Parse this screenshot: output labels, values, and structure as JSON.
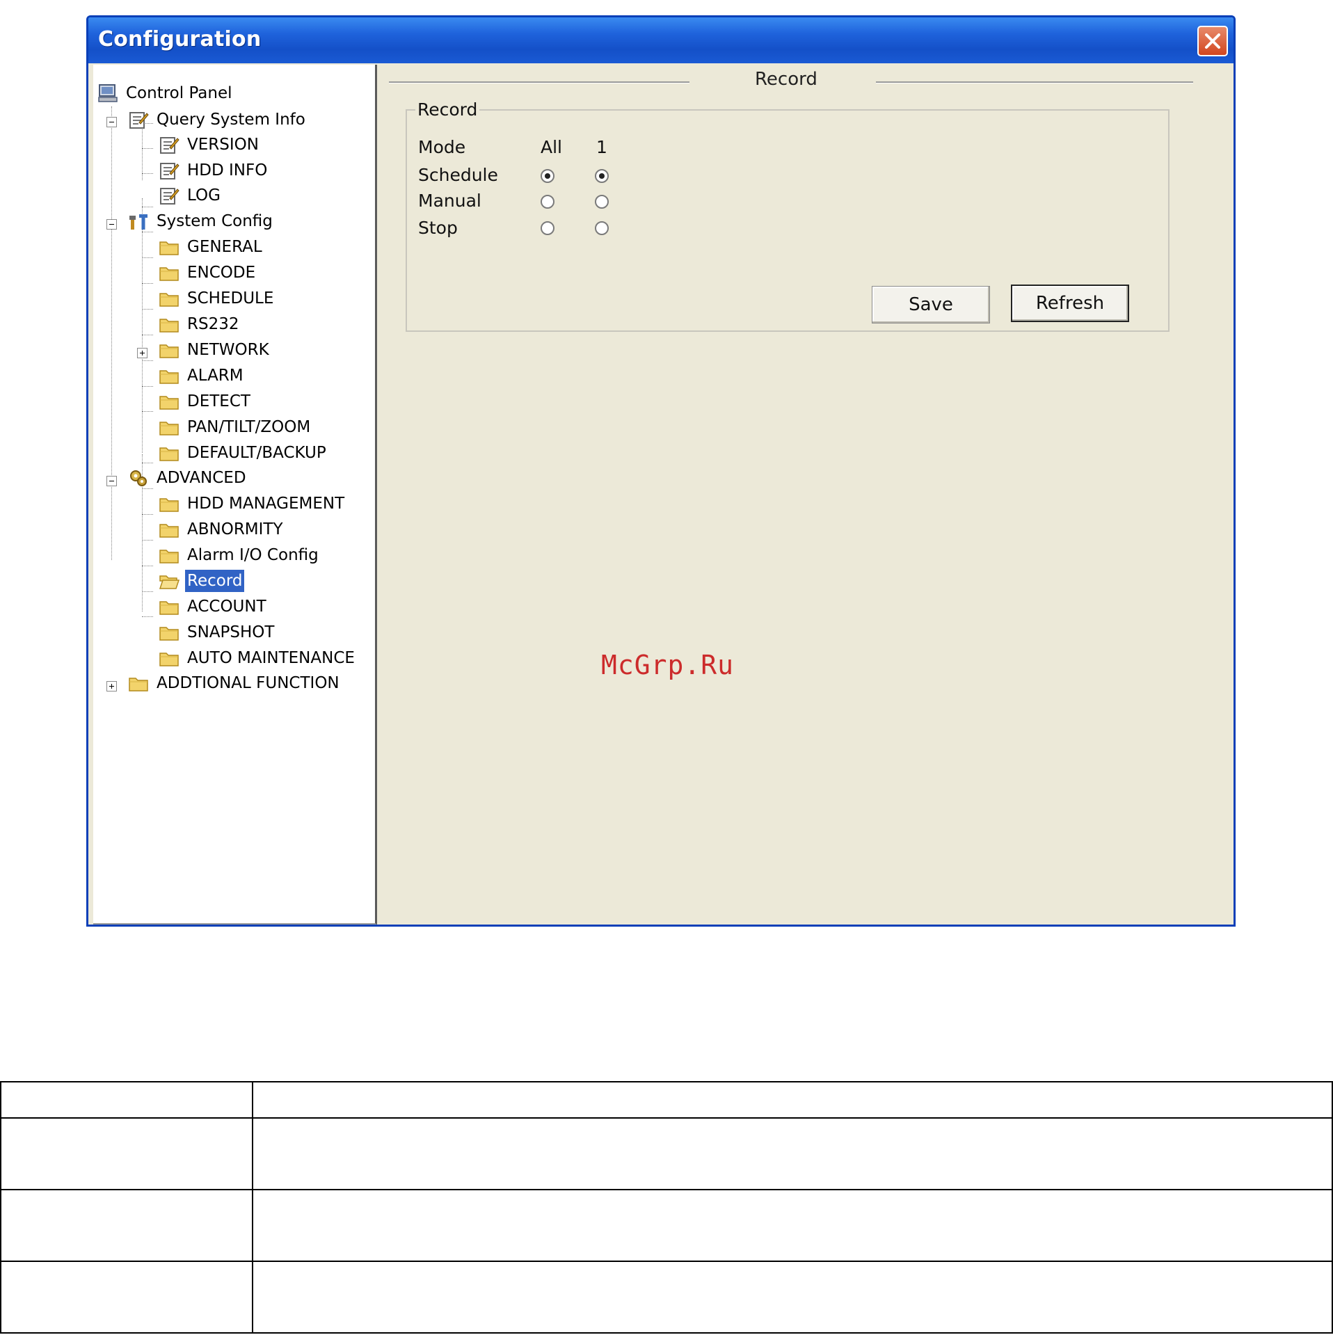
{
  "window": {
    "title": "Configuration",
    "close_icon": "close-icon"
  },
  "tree": {
    "root": "Control Panel",
    "query_system_info": {
      "label": "Query System Info",
      "children": [
        "VERSION",
        "HDD INFO",
        "LOG"
      ]
    },
    "system_config": {
      "label": "System Config",
      "children": [
        "GENERAL",
        "ENCODE",
        "SCHEDULE",
        "RS232",
        "NETWORK",
        "ALARM",
        "DETECT",
        "PAN/TILT/ZOOM",
        "DEFAULT/BACKUP"
      ]
    },
    "advanced": {
      "label": "ADVANCED",
      "children": [
        "HDD MANAGEMENT",
        "ABNORMITY",
        "Alarm I/O Config",
        "Record",
        "ACCOUNT",
        "SNAPSHOT",
        "AUTO MAINTENANCE"
      ]
    },
    "additional": "ADDTIONAL FUNCTION",
    "selected": "Record"
  },
  "record_panel": {
    "header": "Record",
    "group_title": "Record",
    "mode_label": "Mode",
    "columns": [
      "All",
      "1"
    ],
    "rows": [
      {
        "label": "Schedule",
        "all": true,
        "ch1": true
      },
      {
        "label": "Manual",
        "all": false,
        "ch1": false
      },
      {
        "label": "Stop",
        "all": false,
        "ch1": false
      }
    ],
    "save_label": "Save",
    "refresh_label": "Refresh"
  },
  "watermark": "McGrp.Ru",
  "colors": {
    "titlebar": "#1f63dc",
    "selection": "#3163c5",
    "watermark": "#cc2b2b"
  }
}
